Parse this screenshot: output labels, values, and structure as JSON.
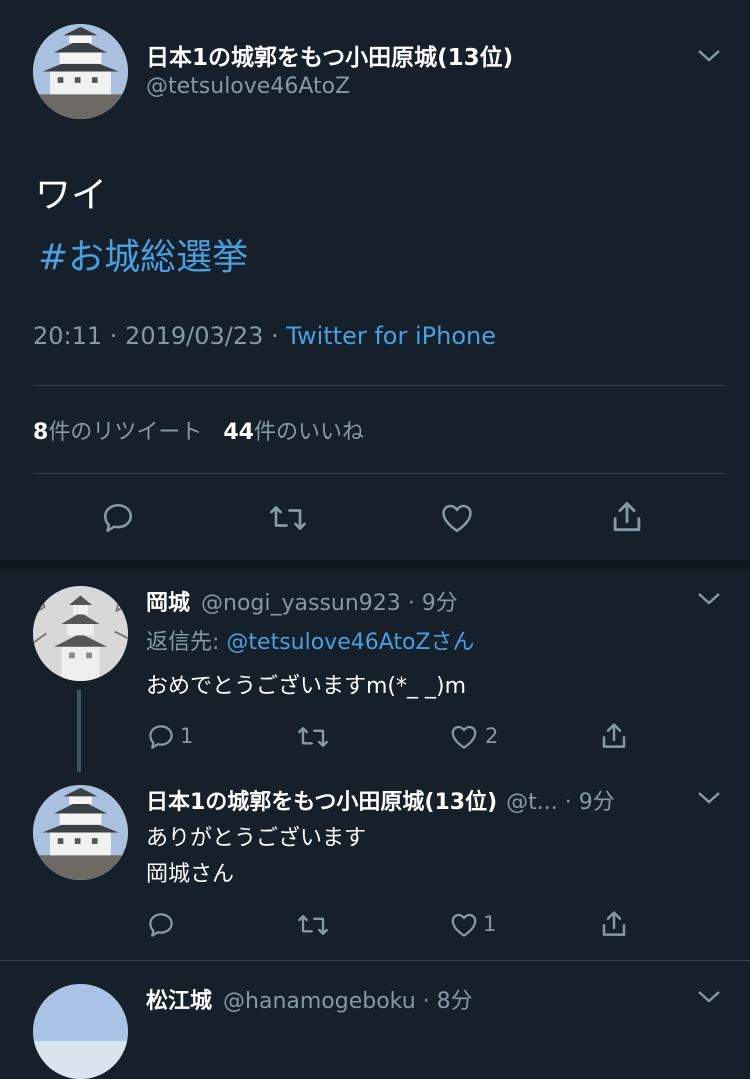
{
  "main_tweet": {
    "display_name": "日本1の城郭をもつ小田原城(13位)",
    "handle": "@tetsulove46AtoZ",
    "text": "ワイ",
    "hashtag": "#お城総選挙",
    "time": "20:11 · 2019/03/23 ·",
    "source": "Twitter for iPhone",
    "retweet_count": "8",
    "retweet_label": "件のリツイート",
    "like_count": "44",
    "like_label": "件のいいね"
  },
  "replies": [
    {
      "display_name": "岡城",
      "handle": "@nogi_yassun923",
      "time": "· 9分",
      "reply_prefix": "返信先:",
      "reply_to": "@tetsulove46AtoZさん",
      "text": "おめでとうございますm(*_ _)m",
      "reply_count": "1",
      "like_count": "2"
    },
    {
      "display_name": "日本1の城郭をもつ小田原城(13位)",
      "handle": "@t...",
      "time": "· 9分",
      "text_line1": "ありがとうございます",
      "text_line2": "岡城さん",
      "like_count": "1"
    },
    {
      "display_name": "松江城",
      "handle": "@hanamogeboku",
      "time": "· 8分"
    }
  ],
  "icons": [
    "chevron-down-icon",
    "reply-icon",
    "retweet-icon",
    "like-icon",
    "share-icon"
  ],
  "colors": {
    "background": "#15202b",
    "link": "#4a9fe0",
    "muted": "#8899a6",
    "divider": "#38444d"
  }
}
